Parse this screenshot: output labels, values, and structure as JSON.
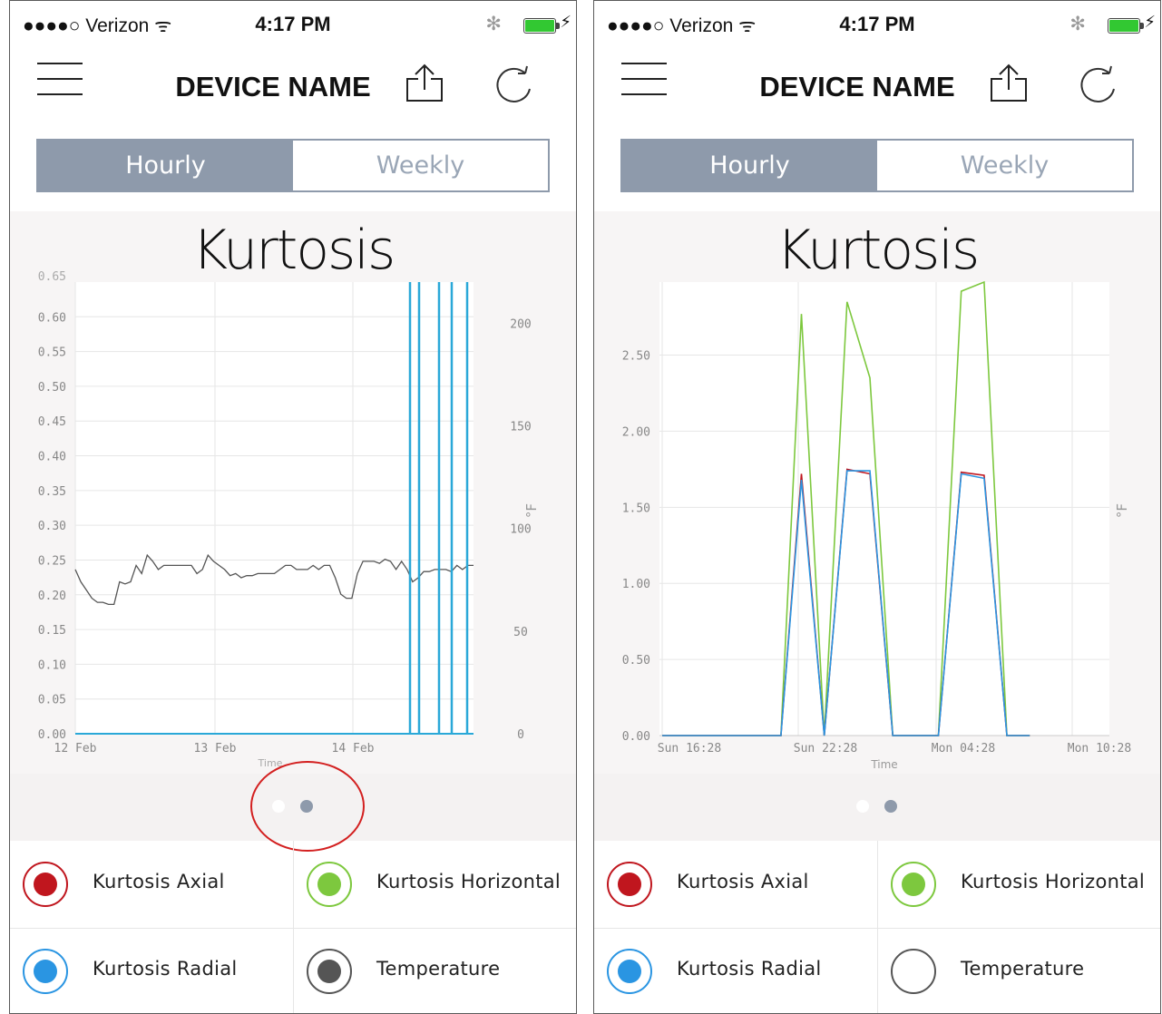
{
  "screens": [
    {
      "status": {
        "carrier": "●●●●○ Verizon ᯤ",
        "time": "4:17 PM"
      },
      "title": "DEVICE NAME",
      "segment": {
        "hourly": "Hourly",
        "weekly": "Weekly",
        "selected": "Hourly"
      },
      "chart_title": "Kurtosis",
      "chart_data": {
        "type": "line",
        "xlabel": "Time",
        "x_ticks": [
          "12 Feb",
          "13 Feb",
          "14 Feb"
        ],
        "y_ticks": [
          "0.00",
          "0.05",
          "0.10",
          "0.15",
          "0.20",
          "0.25",
          "0.30",
          "0.35",
          "0.40",
          "0.45",
          "0.50",
          "0.55",
          "0.60"
        ],
        "y_right_ticks": [
          "0",
          "50",
          "100",
          "150",
          "200"
        ],
        "y_right_label": "°F",
        "ylim": [
          0,
          0.65
        ],
        "y_right_lim": [
          0,
          220
        ],
        "series": [
          {
            "name": "Temperature",
            "color": "#555555",
            "axis": "right",
            "values": [
              80,
              74,
              70,
              66,
              64,
              64,
              63,
              63,
              74,
              73,
              74,
              82,
              78,
              87,
              84,
              80,
              82,
              82,
              82,
              82,
              82,
              82,
              78,
              80,
              87,
              84,
              82,
              80,
              77,
              78,
              76,
              77,
              77,
              78,
              78,
              78,
              78,
              80,
              82,
              82,
              80,
              80,
              80,
              82,
              80,
              82,
              82,
              76,
              68,
              66,
              66,
              78,
              84,
              84,
              84,
              83,
              85,
              84,
              80,
              84,
              80,
              74,
              76,
              79,
              79,
              80,
              80,
              80,
              79,
              82,
              80,
              82,
              82
            ]
          },
          {
            "name": "Kurtosis Radial",
            "color": "#2aa8d8",
            "axis": "left",
            "values": [
              0,
              0,
              0,
              0,
              0,
              0,
              0,
              0,
              0,
              0,
              0,
              0,
              0,
              0,
              0,
              0,
              0,
              0,
              0,
              0,
              0,
              0,
              0,
              0,
              0,
              0,
              0,
              0,
              0,
              0,
              0,
              0,
              0,
              0,
              0,
              0,
              0,
              0,
              0,
              0,
              0,
              0,
              0,
              0,
              0,
              0,
              0,
              0,
              0,
              0,
              0,
              0,
              0,
              0,
              0,
              0,
              0,
              0,
              0,
              0,
              0,
              0,
              0,
              0,
              0,
              0,
              0,
              0,
              0,
              0,
              0,
              0,
              0
            ]
          }
        ]
      },
      "pager": {
        "count": 2,
        "active": 1
      },
      "legend": [
        {
          "label": "Kurtosis Axial",
          "color": "#c0161e",
          "filled": true
        },
        {
          "label": "Kurtosis Horizontal",
          "color": "#7dc83e",
          "filled": true
        },
        {
          "label": "Kurtosis Radial",
          "color": "#2a95e2",
          "filled": true
        },
        {
          "label": "Temperature",
          "color": "#555555",
          "filled": true
        }
      ]
    },
    {
      "status": {
        "carrier": "●●●●○ Verizon ᯤ",
        "time": "4:17 PM"
      },
      "title": "DEVICE NAME",
      "segment": {
        "hourly": "Hourly",
        "weekly": "Weekly",
        "selected": "Hourly"
      },
      "chart_title": "Kurtosis",
      "chart_data": {
        "type": "line",
        "xlabel": "Time",
        "x_ticks": [
          "Sun 16:28",
          "Sun 22:28",
          "Mon 04:28",
          "Mon 10:28"
        ],
        "y_ticks": [
          "0.00",
          "0.50",
          "1.00",
          "1.50",
          "2.00",
          "2.50"
        ],
        "y_right_label": "°F",
        "ylim": [
          0,
          2.98
        ],
        "series": [
          {
            "name": "Kurtosis Horizontal",
            "color": "#7dc83e",
            "points": [
              [
                0,
                0
              ],
              [
                5.2,
                0
              ],
              [
                6.1,
                2.77
              ],
              [
                7.1,
                0
              ],
              [
                8.1,
                2.85
              ],
              [
                9.1,
                2.35
              ],
              [
                10.1,
                0
              ],
              [
                12.1,
                0
              ],
              [
                13.1,
                2.92
              ],
              [
                14.1,
                2.98
              ],
              [
                15.1,
                0
              ],
              [
                16.1,
                0
              ]
            ]
          },
          {
            "name": "Kurtosis Axial",
            "color": "#c0161e",
            "points": [
              [
                0,
                0
              ],
              [
                5.2,
                0
              ],
              [
                6.1,
                1.72
              ],
              [
                7.1,
                0
              ],
              [
                8.1,
                1.75
              ],
              [
                9.1,
                1.72
              ],
              [
                10.1,
                0
              ],
              [
                12.1,
                0
              ],
              [
                13.1,
                1.73
              ],
              [
                14.1,
                1.71
              ],
              [
                15.1,
                0
              ],
              [
                16.1,
                0
              ]
            ]
          },
          {
            "name": "Kurtosis Radial",
            "color": "#2a95e2",
            "points": [
              [
                0,
                0
              ],
              [
                5.2,
                0
              ],
              [
                6.1,
                1.68
              ],
              [
                7.1,
                0
              ],
              [
                8.1,
                1.74
              ],
              [
                9.1,
                1.74
              ],
              [
                10.1,
                0
              ],
              [
                12.1,
                0
              ],
              [
                13.1,
                1.72
              ],
              [
                14.1,
                1.69
              ],
              [
                15.1,
                0
              ],
              [
                16.1,
                0
              ]
            ]
          }
        ]
      },
      "pager": {
        "count": 2,
        "active": 1
      },
      "legend": [
        {
          "label": "Kurtosis Axial",
          "color": "#c0161e",
          "filled": true
        },
        {
          "label": "Kurtosis Horizontal",
          "color": "#7dc83e",
          "filled": true
        },
        {
          "label": "Kurtosis Radial",
          "color": "#2a95e2",
          "filled": true
        },
        {
          "label": "Temperature",
          "color": "#555555",
          "filled": false
        }
      ]
    }
  ],
  "icons": {
    "menu": "hamburger-icon",
    "share": "share-icon",
    "refresh": "refresh-icon",
    "bluetooth": "bluetooth-icon",
    "battery": "battery-icon"
  }
}
